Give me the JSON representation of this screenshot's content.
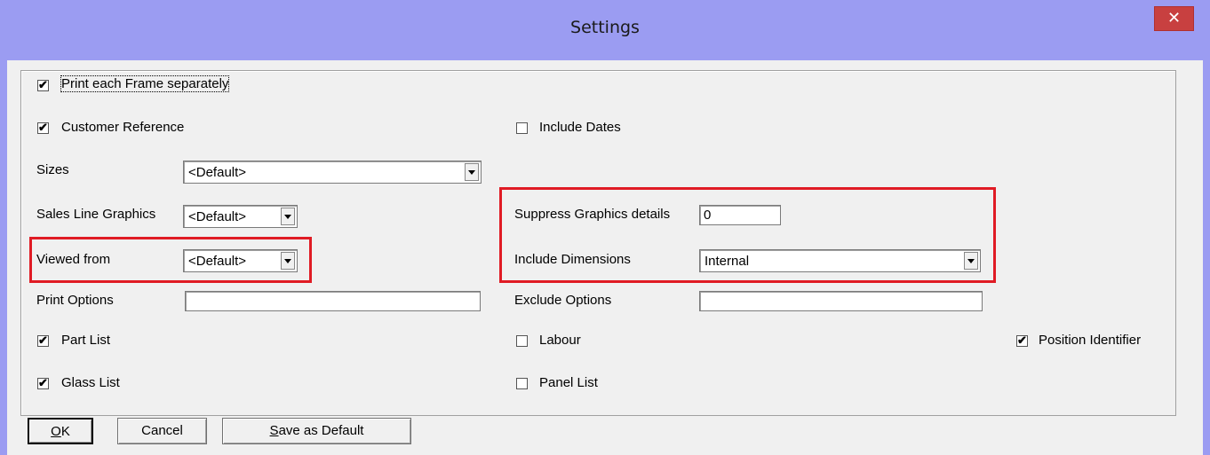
{
  "window": {
    "title": "Settings",
    "close_glyph": "✕"
  },
  "colors": {
    "highlight": "#e01b24",
    "titlebar": "#9b9cf2",
    "dialog_bg": "#f0f0f0"
  },
  "options": {
    "print_each_frame": {
      "label": "Print each Frame separately",
      "checked": true
    },
    "customer_reference": {
      "label": "Customer Reference",
      "checked": true
    },
    "include_dates": {
      "label": "Include Dates",
      "checked": false
    },
    "part_list": {
      "label": "Part List",
      "checked": true
    },
    "glass_list": {
      "label": "Glass List",
      "checked": true
    },
    "labour": {
      "label": "Labour",
      "checked": false
    },
    "panel_list": {
      "label": "Panel List",
      "checked": false
    },
    "position_identifier": {
      "label": "Position Identifier",
      "checked": true
    }
  },
  "fields": {
    "sizes": {
      "label": "Sizes",
      "value": "<Default>"
    },
    "sales_line_graphics": {
      "label": "Sales Line Graphics",
      "value": "<Default>"
    },
    "viewed_from": {
      "label": "Viewed from",
      "value": "<Default>"
    },
    "print_options": {
      "label": "Print Options",
      "value": ""
    },
    "suppress_graphics_details": {
      "label": "Suppress Graphics details",
      "value": "0"
    },
    "include_dimensions": {
      "label": "Include Dimensions",
      "value": "Internal"
    },
    "exclude_options": {
      "label": "Exclude Options",
      "value": ""
    }
  },
  "buttons": {
    "ok": {
      "mnemonic": "O",
      "rest": "K"
    },
    "cancel": {
      "label": "Cancel"
    },
    "save_default": {
      "mnemonic": "S",
      "rest": "ave as Default"
    }
  },
  "check_glyph": "✔"
}
